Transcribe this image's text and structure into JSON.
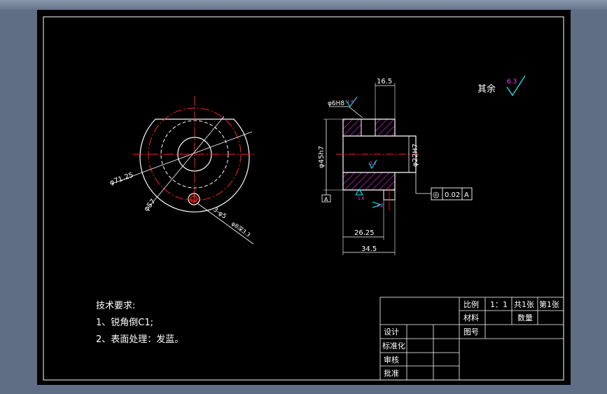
{
  "palette": {
    "background": "#5f6e84",
    "sheet": "#000000",
    "line": "#ffffff",
    "center": "#ff2020",
    "hatch": "#c020c0",
    "roughness": "#00ffff",
    "roughness_text": "#ff40ff"
  },
  "left_view": {
    "dim_outer": "φ71.25",
    "dim_pitch": "φ57",
    "dim_holes": "3-φ5",
    "dim_counterbore": "φ8深3.3"
  },
  "section_view": {
    "dim_top": "16.5",
    "dim_outer": "φ45h7",
    "dim_bore": "φ22H7",
    "dim_step": "26.25",
    "dim_total": "34.5",
    "dim_small_hole": "φ6H8",
    "datum": "A",
    "fcf_symbol": "◎",
    "fcf_value": "0.02",
    "fcf_datum": "A",
    "rough_1": "1.6",
    "rough_2": "3.2",
    "rough_3": "1.6",
    "rough_4": "3.2"
  },
  "other_surface": {
    "label": "其余",
    "value": "6.3"
  },
  "tech_requirements": {
    "title": "技术要求:",
    "item1": "1、锐角倒C1;",
    "item2": "2、表面处理：发蓝。"
  },
  "title_block": {
    "scale_label": "比例",
    "scale_value": "1：1",
    "sheets_total": "共1张",
    "sheet_no": "第1张",
    "material_label": "材料",
    "quantity_label": "数量",
    "drawing_no_label": "图号",
    "design_label": "设计",
    "standard_label": "标准化",
    "review_label": "审核",
    "approve_label": "批准"
  }
}
